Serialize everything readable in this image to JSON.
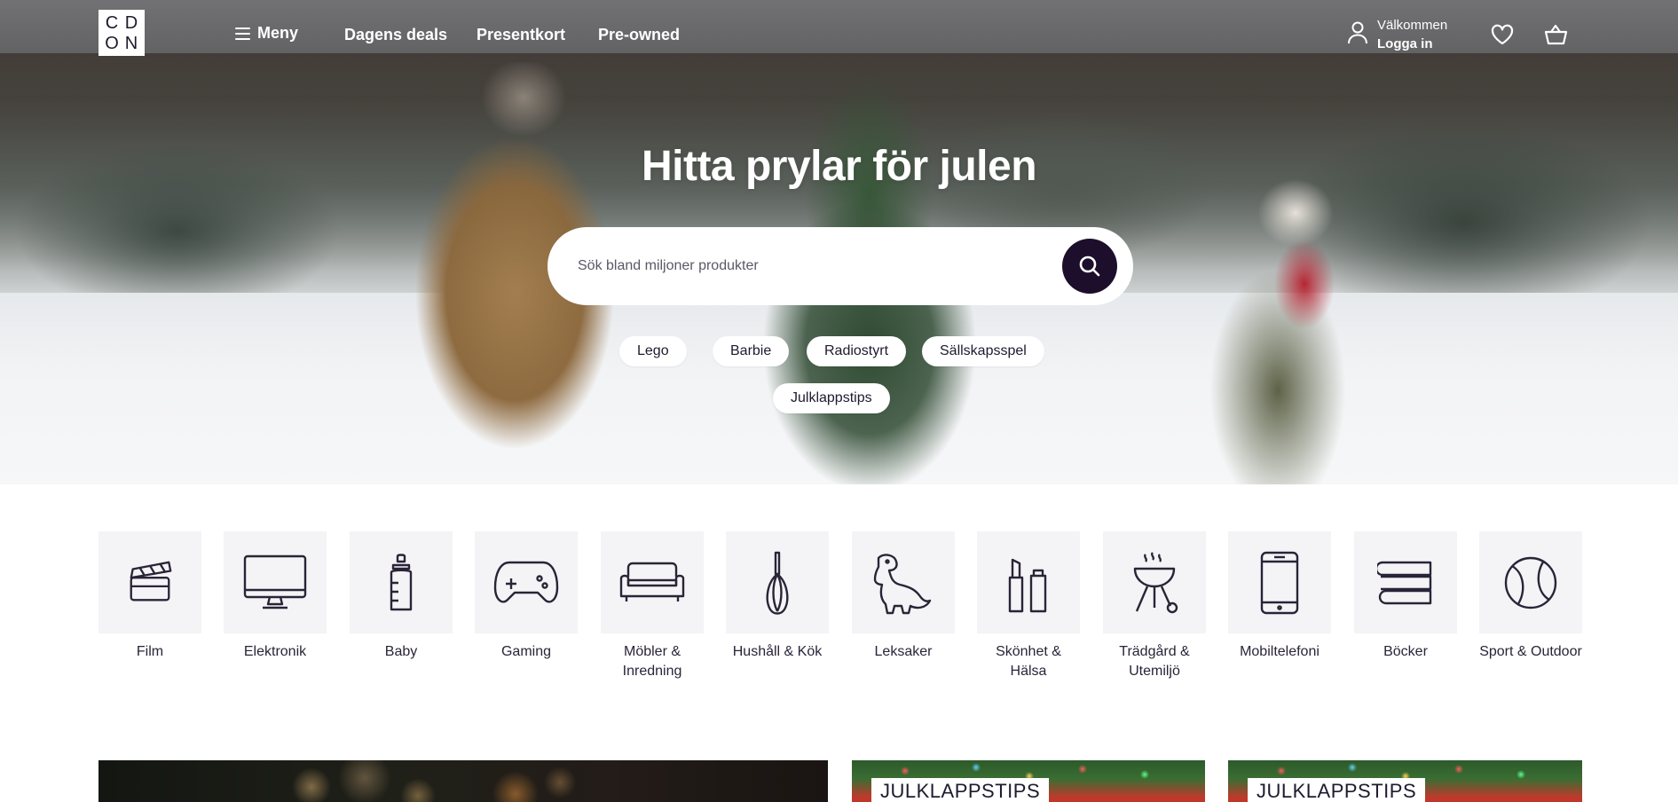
{
  "header": {
    "logo_letters": [
      "C",
      "D",
      "O",
      "N"
    ],
    "menu_label": "Meny",
    "nav_links": [
      "Dagens deals",
      "Presentkort",
      "Pre-owned"
    ],
    "account_greeting": "Välkommen",
    "account_login": "Logga in",
    "icons": [
      "user-icon",
      "heart-icon",
      "basket-icon",
      "hamburger-icon"
    ]
  },
  "hero": {
    "title": "Hitta prylar för julen",
    "search_placeholder": "Sök bland miljoner produkter",
    "chips": [
      "Lego",
      "Barbie",
      "Radiostyrt",
      "Sällskapsspel",
      "Julklappstips"
    ]
  },
  "categories": [
    {
      "label": "Film",
      "icon": "clapperboard-icon"
    },
    {
      "label": "Elektronik",
      "icon": "monitor-icon"
    },
    {
      "label": "Baby",
      "icon": "baby-bottle-icon"
    },
    {
      "label": "Gaming",
      "icon": "gamepad-icon"
    },
    {
      "label": "Möbler & Inredning",
      "icon": "sofa-icon"
    },
    {
      "label": "Hushåll & Kök",
      "icon": "whisk-icon"
    },
    {
      "label": "Leksaker",
      "icon": "dinosaur-icon"
    },
    {
      "label": "Skönhet & Hälsa",
      "icon": "cosmetics-icon"
    },
    {
      "label": "Trädgård & Utemiljö",
      "icon": "grill-icon"
    },
    {
      "label": "Mobiltelefoni",
      "icon": "phone-icon"
    },
    {
      "label": "Böcker",
      "icon": "books-icon"
    },
    {
      "label": "Sport & Outdoor",
      "icon": "ball-icon"
    }
  ],
  "promos": [
    {
      "tag": ""
    },
    {
      "tag": "JULKLAPPSTIPS"
    },
    {
      "tag": "JULKLAPPSTIPS"
    }
  ],
  "colors": {
    "brand_dark": "#1d0f2c",
    "text": "#1f1a2e",
    "tile_bg": "#f4f4f6"
  }
}
